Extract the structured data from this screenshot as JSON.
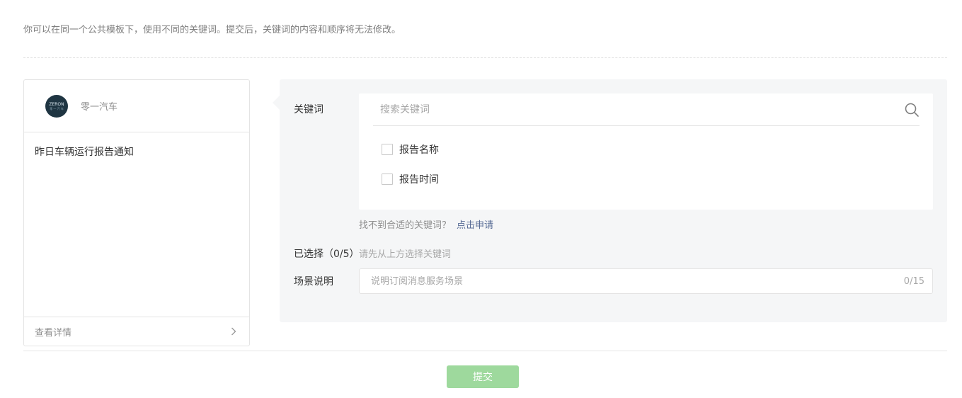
{
  "tip": "你可以在同一个公共模板下，使用不同的关键词。提交后，关键词的内容和顺序将无法修改。",
  "preview": {
    "avatar_text": "ZERON",
    "avatar_sub": "零 一 汽 车",
    "brand_name": "零一汽车",
    "title": "昨日车辆运行报告通知",
    "detail_label": "查看详情"
  },
  "keywords": {
    "label": "关键词",
    "search_placeholder": "搜索关键词",
    "options": [
      {
        "label": "报告名称",
        "checked": false
      },
      {
        "label": "报告时间",
        "checked": false
      }
    ],
    "hint": "找不到合适的关键词？",
    "apply_link": "点击申请"
  },
  "selected": {
    "label": "已选择（0/5）",
    "placeholder": "请先从上方选择关键词"
  },
  "scene": {
    "label": "场景说明",
    "placeholder": "说明订阅消息服务场景",
    "counter": "0/15"
  },
  "submit_label": "提交",
  "colors": {
    "link": "#576b95",
    "submit_disabled": "#9ed99d",
    "panel_bg": "#f5f6f7"
  }
}
